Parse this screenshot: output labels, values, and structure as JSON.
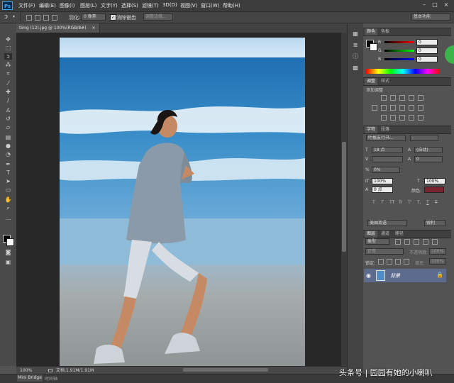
{
  "app": {
    "logo": "Ps"
  },
  "menu": [
    "文件(F)",
    "编辑(E)",
    "图像(I)",
    "图层(L)",
    "文字(Y)",
    "选择(S)",
    "滤镜(T)",
    "3D(D)",
    "视图(V)",
    "窗口(W)",
    "帮助(H)"
  ],
  "window_controls": [
    "–",
    "□",
    "×"
  ],
  "options": {
    "feather_label": "羽化:",
    "feather_value": "0 像素",
    "antialias_label": "消除锯齿",
    "refine_edge": "调整边缘...",
    "workspace": "基本功能"
  },
  "document": {
    "tab_title": "timg (12).jpg @ 100%(RGB/8#)",
    "close": "×",
    "zoom": "100%",
    "doc_info": "文档:1.91M/1.91M"
  },
  "bottom_tabs": [
    "Mini Bridge",
    "时间轴"
  ],
  "color_panel": {
    "tabs": [
      "颜色",
      "色板"
    ],
    "channels": [
      {
        "label": "R",
        "value": "0"
      },
      {
        "label": "G",
        "value": "0"
      },
      {
        "label": "B",
        "value": "0"
      }
    ]
  },
  "adjust_panel": {
    "tabs": [
      "调整",
      "样式"
    ],
    "title": "添加调整"
  },
  "char_panel": {
    "tabs": [
      "字符",
      "段落"
    ],
    "font_family": "叶根友行书...",
    "font_style": "-",
    "font_size": "18 点",
    "leading": "(自动)",
    "kerning": "",
    "tracking": "0",
    "tsume": "0%",
    "v_scale": "100%",
    "h_scale": "100%",
    "baseline": "0 点",
    "color_label": "颜色:",
    "language": "美国英语",
    "aa": "锐利",
    "style_buttons": [
      "T",
      "T",
      "TT",
      "Tr",
      "T'",
      "T,",
      "T",
      "T"
    ]
  },
  "layers_panel": {
    "tabs": [
      "图层",
      "通道",
      "路径"
    ],
    "filter": "类型",
    "blend": "正常",
    "opacity_label": "不透明度:",
    "opacity": "100%",
    "lock_label": "锁定:",
    "fill_label": "填充:",
    "fill": "100%",
    "layers": [
      {
        "name": "背景"
      }
    ]
  },
  "watermark": "头条号 | 园园有她的小喇叭",
  "colors": {
    "accent": "#31a8ff",
    "layer_selected": "#5d6c8c",
    "text_color_swatch": "#7a2430"
  }
}
